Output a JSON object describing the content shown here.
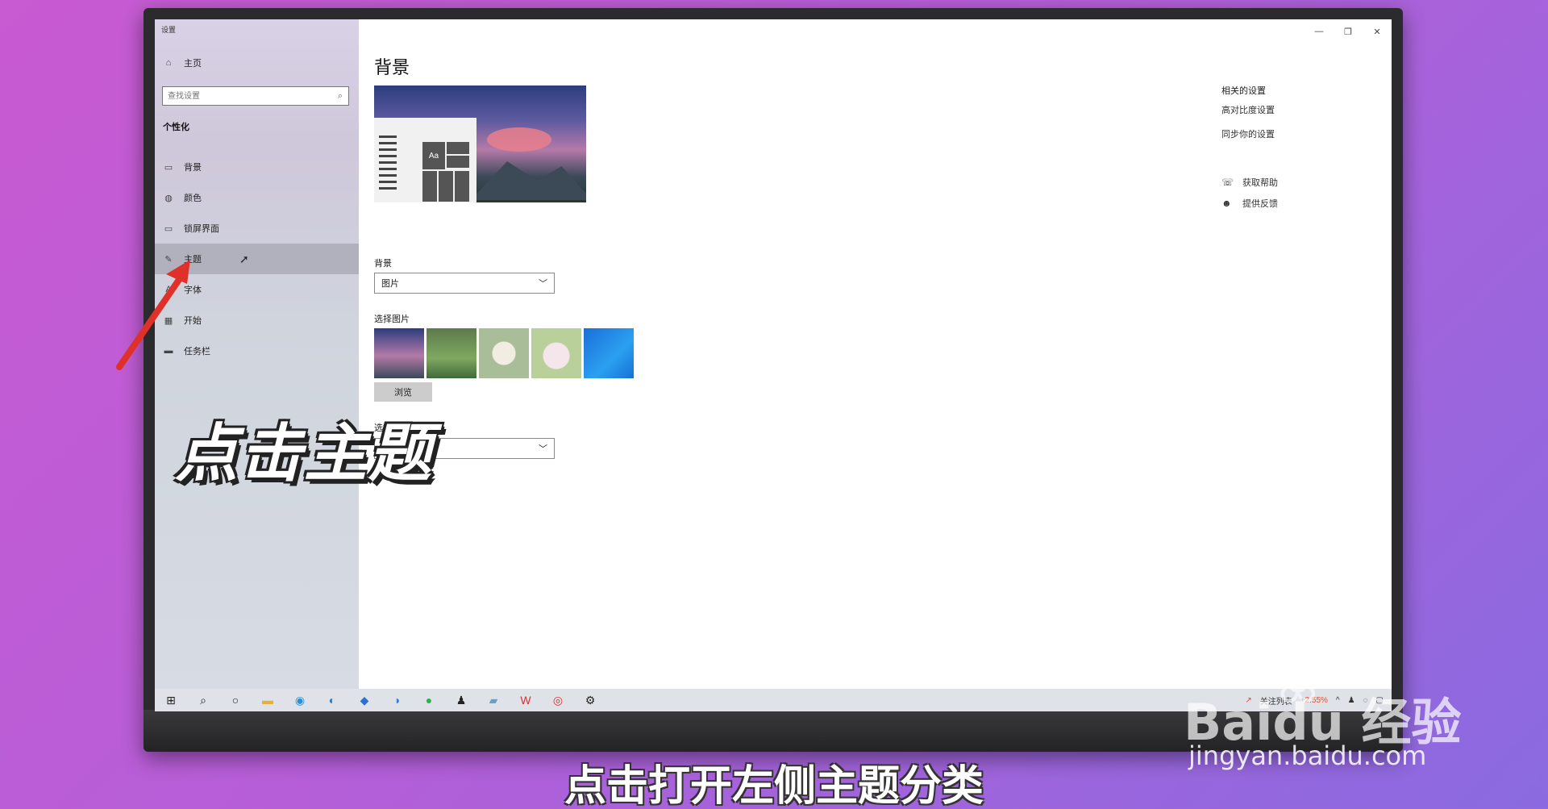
{
  "window": {
    "title": "设置"
  },
  "sidebar": {
    "home_label": "主页",
    "search_placeholder": "查找设置",
    "section_title": "个性化",
    "items": [
      {
        "label": "背景",
        "icon": "image-icon"
      },
      {
        "label": "颜色",
        "icon": "palette-icon"
      },
      {
        "label": "锁屏界面",
        "icon": "lock-screen-icon"
      },
      {
        "label": "主题",
        "icon": "theme-icon",
        "active": true
      },
      {
        "label": "字体",
        "icon": "font-icon"
      },
      {
        "label": "开始",
        "icon": "start-icon"
      },
      {
        "label": "任务栏",
        "icon": "taskbar-icon"
      }
    ]
  },
  "main": {
    "title": "背景",
    "preview_tile_text": "Aa",
    "background_label": "背景",
    "background_value": "图片",
    "choose_picture_label": "选择图片",
    "browse_label": "浏览",
    "fit_label": "选择契合度",
    "fit_value": "拉伸"
  },
  "related": {
    "title": "相关的设置",
    "links": [
      "高对比度设置",
      "同步你的设置"
    ],
    "help": "获取帮助",
    "feedback": "提供反馈"
  },
  "taskbar": {
    "stock_label": "关注列表",
    "stock_change": "+2.55%"
  },
  "overlay": {
    "caption": "点击主题",
    "subtitle": "点击打开左侧主题分类",
    "watermark_logo": "Baidu 经验",
    "watermark_url": "jingyan.baidu.com"
  },
  "colors": {
    "accent_red": "#e0302a",
    "taskbar_bg": "#dfe2e8",
    "active_item_bg": "#8c8c96"
  }
}
